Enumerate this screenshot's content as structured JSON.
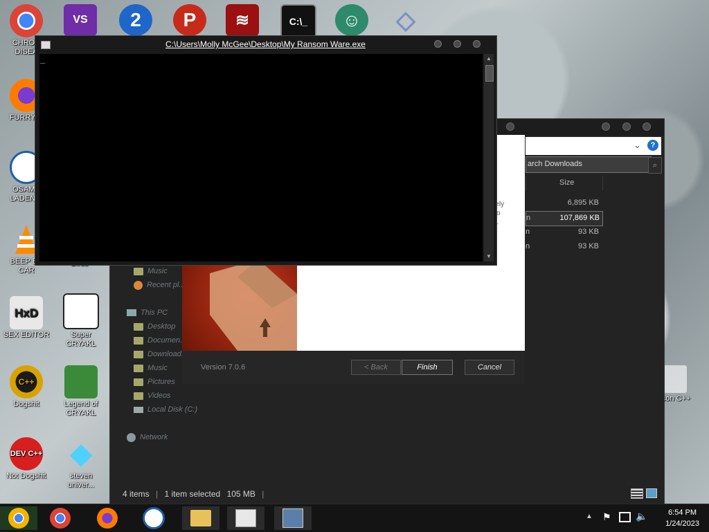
{
  "desktop": {
    "icons": [
      {
        "label": "CHRON\nDISEA",
        "glyph": "",
        "color": "#4285f4"
      },
      {
        "label": "FURRY C",
        "glyph": "",
        "color": "#ff7b00"
      },
      {
        "label": "OSAMA\nLADEN E",
        "glyph": "",
        "color": "#1f5fa8"
      },
      {
        "label": "BEEP BE\nCAR",
        "glyph": "",
        "color": "#ff8a00"
      },
      {
        "label": "Birds",
        "glyph": "",
        "color": "transparent"
      },
      {
        "label": "SEX EDITOR",
        "glyph": "HxD",
        "color": "#e8e8e8"
      },
      {
        "label": "Super CRYAKL",
        "glyph": "",
        "color": "#ffffff"
      },
      {
        "label": "Dogshit",
        "glyph": "C++",
        "color": "#d9a200"
      },
      {
        "label": "Legend of CRYAKL",
        "glyph": "",
        "color": "#3a8a3a"
      },
      {
        "label": "Not Dogshit",
        "glyph": "DEV C++",
        "color": "#d71f1f"
      },
      {
        "label": "steven\nuniver...",
        "glyph": "◆",
        "color": "transparent"
      },
      {
        "label": "Icon C++",
        "glyph": "",
        "color": "transparent"
      }
    ],
    "top_icons": [
      {
        "glyph": "VS",
        "color": "#6f2da8"
      },
      {
        "glyph": "2",
        "color": "#1e66c9"
      },
      {
        "glyph": "P",
        "color": "#c82a1a"
      },
      {
        "glyph": "≋",
        "color": "#9b1010"
      },
      {
        "glyph": "C:\\_",
        "color": "#111111"
      },
      {
        "glyph": "☺",
        "color": "#2d8a6b"
      },
      {
        "glyph": "◇",
        "color": "#7b8fc7"
      }
    ]
  },
  "console": {
    "title": "C:\\Users\\Molly McGee\\Desktop\\My Ransom Ware.exe",
    "cursor": "_"
  },
  "explorer": {
    "search_placeholder": "arch Downloads",
    "column_size": "Size",
    "sizes": [
      "6,895 KB",
      "107,869 KB",
      "93 KB",
      "93 KB"
    ],
    "name_fragments": [
      "",
      "n",
      "n",
      "n"
    ],
    "nav": {
      "music": "Music",
      "recent": "Recent pl...",
      "this_pc": "This PC",
      "desktop": "Desktop",
      "documents": "Documen...",
      "downloads": "Download...",
      "music2": "Music",
      "pictures": "Pictures",
      "videos": "Videos",
      "local_disk": "Local Disk (C:)",
      "network": "Network"
    },
    "status": {
      "items": "4 items",
      "selected": "1 item selected",
      "size": "105 MB"
    }
  },
  "installer": {
    "text_fragment": [
      "rely",
      "To",
      "n."
    ],
    "version": "Version 7.0.6",
    "back": "< Back",
    "finish": "Finish",
    "cancel": "Cancel"
  },
  "taskbar": {
    "time": "6:54 PM",
    "date": "1/24/2023"
  }
}
